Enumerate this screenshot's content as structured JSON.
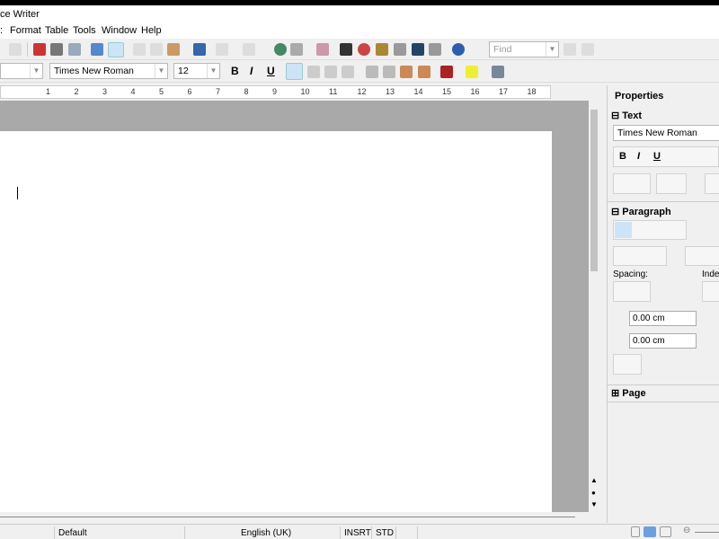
{
  "window": {
    "title": "ce Writer"
  },
  "menu": [
    ":",
    "Format",
    "Table",
    "Tools",
    "Window",
    "Help"
  ],
  "toolbar": {
    "find_placeholder": "Find"
  },
  "formatting": {
    "paragraph_style": "",
    "font_name": "Times New Roman",
    "font_size": "12"
  },
  "ruler": {
    "ticks": [
      "1",
      "2",
      "3",
      "4",
      "5",
      "6",
      "7",
      "8",
      "9",
      "10",
      "11",
      "12",
      "13",
      "14",
      "15",
      "16",
      "17",
      "18"
    ]
  },
  "sidebar": {
    "title": "Properties",
    "text_section": "Text",
    "font_name": "Times New Roman",
    "paragraph_section": "Paragraph",
    "spacing_label": "Spacing:",
    "indent_label": "Inden",
    "above_spacing": "0.00 cm",
    "below_spacing": "0.00 cm",
    "page_section": "Page",
    "bold": "B",
    "italic": "I",
    "underline": "U"
  },
  "statusbar": {
    "page_style": "Default",
    "language": "English (UK)",
    "insert_mode": "INSRT",
    "selection_mode": "STD"
  }
}
